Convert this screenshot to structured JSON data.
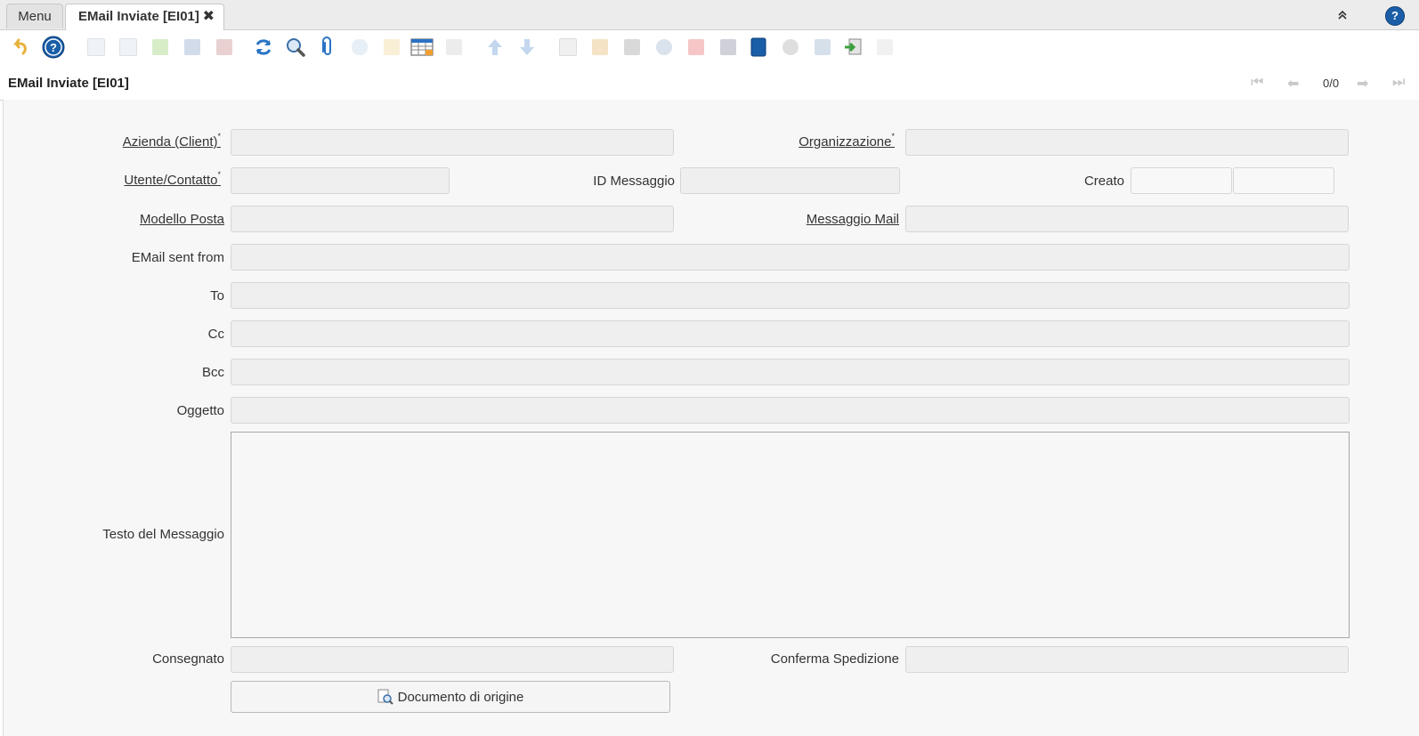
{
  "tabs": {
    "menu_label": "Menu",
    "active_label": "EMail Inviate [EI01]",
    "close_glyph": "✖"
  },
  "header": {
    "collapse_glyph": "⌃",
    "help_glyph": "?"
  },
  "toolbar": {
    "buttons": [
      {
        "name": "undo-icon",
        "enabled": true
      },
      {
        "name": "help-icon",
        "enabled": true
      },
      {
        "name": "new-record-icon",
        "enabled": false
      },
      {
        "name": "copy-record-icon",
        "enabled": false
      },
      {
        "name": "delete-icon",
        "enabled": false
      },
      {
        "name": "save-icon",
        "enabled": false
      },
      {
        "name": "save-create-icon",
        "enabled": false
      },
      {
        "name": "refresh-icon",
        "enabled": true
      },
      {
        "name": "find-icon",
        "enabled": true
      },
      {
        "name": "attachment-icon",
        "enabled": true
      },
      {
        "name": "chat-icon",
        "enabled": false
      },
      {
        "name": "archive-icon",
        "enabled": false
      },
      {
        "name": "grid-toggle-icon",
        "enabled": true
      },
      {
        "name": "detail-icon",
        "enabled": false
      },
      {
        "name": "parent-record-icon",
        "enabled": false
      },
      {
        "name": "child-record-icon",
        "enabled": false
      },
      {
        "name": "report-icon",
        "enabled": false
      },
      {
        "name": "archive-view-icon",
        "enabled": false
      },
      {
        "name": "print-icon",
        "enabled": false
      },
      {
        "name": "zoom-across-icon",
        "enabled": false
      },
      {
        "name": "active-workflows-icon",
        "enabled": false
      },
      {
        "name": "requests-icon",
        "enabled": false
      },
      {
        "name": "product-info-icon",
        "enabled": true
      },
      {
        "name": "process-icon",
        "enabled": false
      },
      {
        "name": "export-icon",
        "enabled": false
      },
      {
        "name": "import-icon",
        "enabled": true
      },
      {
        "name": "post-it-icon",
        "enabled": false
      }
    ]
  },
  "window": {
    "title": "EMail Inviate [EI01]",
    "record_count": "0/0",
    "nav": {
      "first": "⏮",
      "prev": "⬅",
      "next": "➡",
      "last": "⏭"
    }
  },
  "form": {
    "client_label": "Azienda (Client)",
    "org_label": "Organizzazione",
    "user_label": "Utente/Contatto",
    "message_id_label": "ID Messaggio",
    "created_label": "Creato",
    "mail_template_label": "Modello Posta",
    "mail_message_label": "Messaggio Mail",
    "email_from_label": "EMail sent from",
    "to_label": "To",
    "cc_label": "Cc",
    "bcc_label": "Bcc",
    "subject_label": "Oggetto",
    "body_label": "Testo del Messaggio",
    "delivered_label": "Consegnato",
    "delivery_confirm_label": "Conferma Spedizione",
    "source_doc_button": "Documento di origine",
    "mandatory_marker": "*"
  },
  "colors": {
    "help_blue": "#1a5ea8",
    "field_bg": "#efefef",
    "panel_bg": "#f7f7f7"
  }
}
